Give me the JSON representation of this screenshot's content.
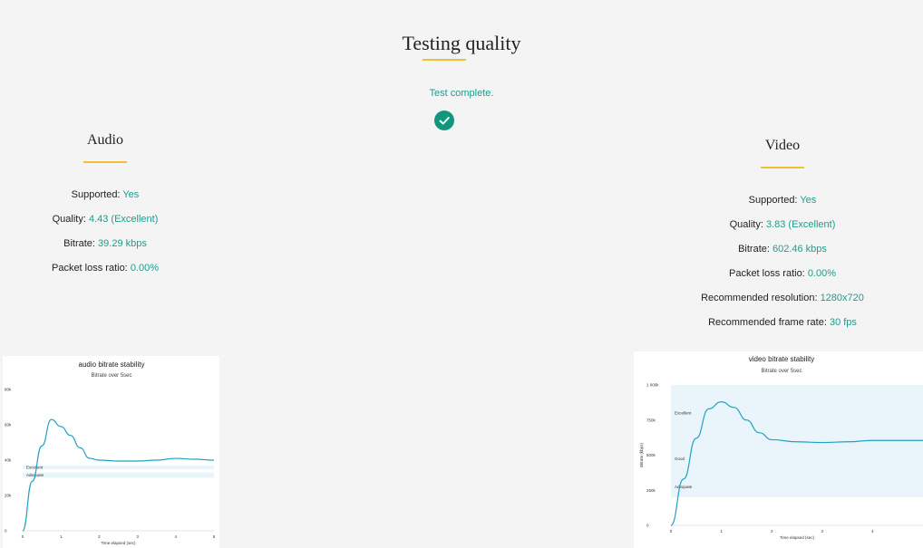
{
  "header": {
    "title": "Testing quality"
  },
  "status": {
    "text": "Test complete.",
    "icon": "check-circle-icon"
  },
  "colors": {
    "accent": "#1a9e8f",
    "underline": "#f2c037",
    "check": "#12967e",
    "line": "#1fa3c4",
    "band": "#e9f4fb"
  },
  "audio": {
    "title": "Audio",
    "stats": [
      {
        "label": "Supported: ",
        "value": "Yes"
      },
      {
        "label": "Quality: ",
        "value": "4.43 (Excellent)"
      },
      {
        "label": "Bitrate: ",
        "value": "39.29 kbps"
      },
      {
        "label": "Packet loss ratio: ",
        "value": "0.00%"
      }
    ]
  },
  "video": {
    "title": "Video",
    "stats": [
      {
        "label": "Supported: ",
        "value": "Yes"
      },
      {
        "label": "Quality: ",
        "value": "3.83 (Excellent)"
      },
      {
        "label": "Bitrate: ",
        "value": "602.46 kbps"
      },
      {
        "label": "Packet loss ratio: ",
        "value": "0.00%"
      },
      {
        "label": "Recommended resolution: ",
        "value": "1280x720"
      },
      {
        "label": "Recommended frame rate: ",
        "value": "30 fps"
      }
    ]
  },
  "chart_data": [
    {
      "type": "line",
      "title": "audio bitrate stability",
      "subtitle": "Bitrate over 5sec",
      "xlabel": "Time elapsed (sec)",
      "ylabel": "",
      "xlim": [
        0,
        5
      ],
      "ylim": [
        0,
        80
      ],
      "x_ticks": [
        "0",
        "1",
        "2",
        "3",
        "4",
        "5"
      ],
      "y_ticks": [
        "0",
        "20k",
        "40k",
        "60k",
        "80k"
      ],
      "bands": [
        {
          "label": "Excellent",
          "from": 35,
          "to": 37
        },
        {
          "label": "Adequate",
          "from": 30,
          "to": 33
        }
      ],
      "series": [
        {
          "x": [
            0,
            0.25,
            0.5,
            0.75,
            1,
            1.25,
            1.5,
            1.75,
            2,
            2.5,
            3,
            3.5,
            4,
            4.5,
            5
          ],
          "y": [
            0,
            28,
            48,
            63,
            59,
            54,
            47,
            41,
            40,
            39.5,
            39.5,
            40,
            41,
            40.5,
            40
          ]
        }
      ]
    },
    {
      "type": "line",
      "title": "video bitrate stability",
      "subtitle": "Bitrate over 5sec",
      "xlabel": "Time elapsed (sec)",
      "ylabel": "Bitrate (kbps)",
      "xlim": [
        0,
        5
      ],
      "ylim": [
        0,
        1000
      ],
      "x_ticks": [
        "0",
        "1",
        "2",
        "3",
        "4"
      ],
      "y_ticks": [
        "0",
        "250k",
        "500k",
        "750k",
        "1 000k"
      ],
      "bands": [
        {
          "label": "Excellent",
          "from": 600,
          "to": 1000
        },
        {
          "label": "Good",
          "from": 350,
          "to": 600
        },
        {
          "label": "Adequate",
          "from": 200,
          "to": 350
        }
      ],
      "series": [
        {
          "x": [
            0,
            0.25,
            0.5,
            0.75,
            1,
            1.25,
            1.5,
            1.75,
            2,
            2.5,
            3,
            3.5,
            4,
            4.5,
            5
          ],
          "y": [
            0,
            330,
            620,
            830,
            880,
            840,
            750,
            660,
            610,
            595,
            590,
            595,
            605,
            605,
            605
          ]
        }
      ]
    }
  ]
}
